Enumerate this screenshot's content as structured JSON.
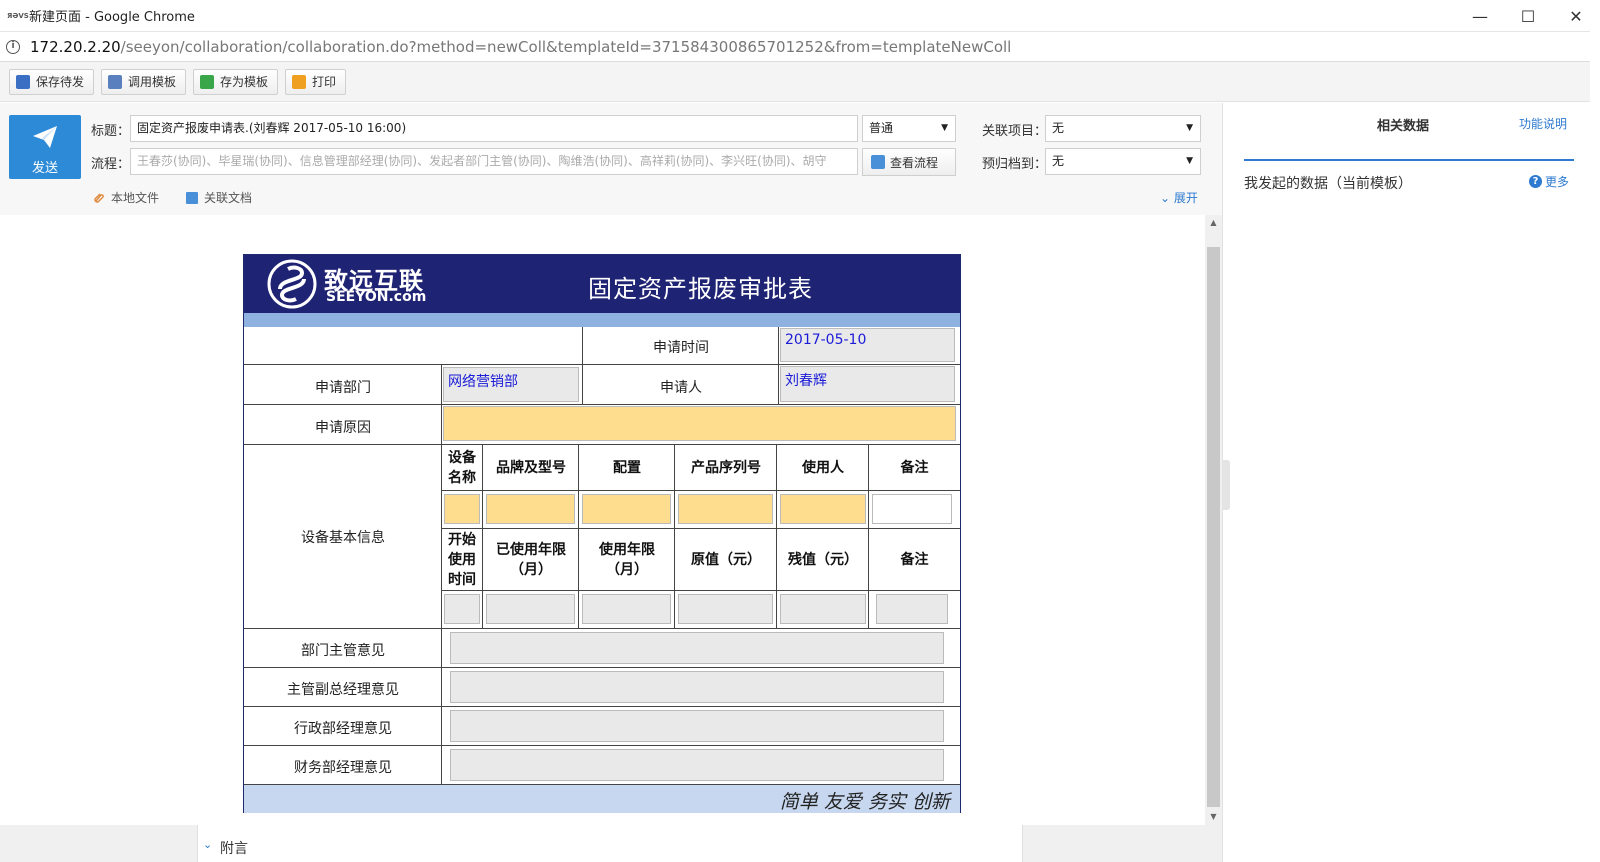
{
  "window": {
    "title": "新建页面 - Google Chrome",
    "favicon_text": "ЯƏVS",
    "controls": {
      "minimize": "—",
      "maximize": "☐",
      "close": "✕"
    }
  },
  "address": {
    "host": "172.20.2.20",
    "path": "/seeyon/collaboration/collaboration.do?method=newColl&templateId=371584300865701252&from=templateNewColl"
  },
  "toolbar": {
    "buttons": [
      {
        "label": "保存待发",
        "icon": "save-icon",
        "color": "#3b6fc4"
      },
      {
        "label": "调用模板",
        "icon": "template-icon",
        "color": "#3b6fc4"
      },
      {
        "label": "存为模板",
        "icon": "save-template-icon",
        "color": "#3aa64a"
      },
      {
        "label": "打印",
        "icon": "print-icon",
        "color": "#f0a020"
      }
    ]
  },
  "header": {
    "send_label": "发送",
    "subject_label": "标题：",
    "subject_value": "固定资产报废申请表.(刘春辉 2017-05-10 16:00)",
    "priority_value": "普通",
    "flow_label": "流程：",
    "flow_value": "王春莎(协同)、毕星瑞(协同)、信息管理部经理(协同)、发起者部门主管(协同)、陶维浩(协同)、高祥莉(协同)、李兴旺(协同)、胡守",
    "view_flow_label": "查看流程",
    "related_project_label": "关联项目：",
    "related_project_value": "无",
    "archive_label": "预归档到：",
    "archive_value": "无",
    "local_file_label": "本地文件",
    "related_doc_label": "关联文档",
    "expand_label": "展开"
  },
  "form": {
    "logo_cn": "致远互联",
    "logo_en": "SEEYON.com",
    "title": "固定资产报废审批表",
    "apply_time_label": "申请时间",
    "apply_time_value": "2017-05-10",
    "dept_label": "申请部门",
    "dept_value": "网络营销部",
    "applicant_label": "申请人",
    "applicant_value": "刘春辉",
    "reason_label": "申请原因",
    "reason_value": "",
    "equipment_label": "设备基本信息",
    "headers1": [
      "设备名称",
      "品牌及型号",
      "配置",
      "产品序列号",
      "使用人",
      "备注"
    ],
    "headers2": [
      "开始使用时间",
      "已使用年限（月）",
      "使用年限（月）",
      "原值（元）",
      "残值（元）",
      "备注"
    ],
    "opinion_labels": [
      "部门主管意见",
      "主管副总经理意见",
      "行政部经理意见",
      "财务部经理意见"
    ],
    "slogan": "简单 友爱 务实 创新",
    "colors": {
      "header_bg": "#1f2373",
      "band": "#8fb1e0",
      "footer": "#c7d7ef",
      "required_field": "#ffdd8e",
      "readonly_field": "#e9e9e9",
      "value_text": "#1b1bd8"
    }
  },
  "attach_bar": {
    "label": "附言"
  },
  "right_panel": {
    "title": "相关数据",
    "help": "功能说明",
    "subtitle": "我发起的数据（当前模板）",
    "more": "更多"
  }
}
